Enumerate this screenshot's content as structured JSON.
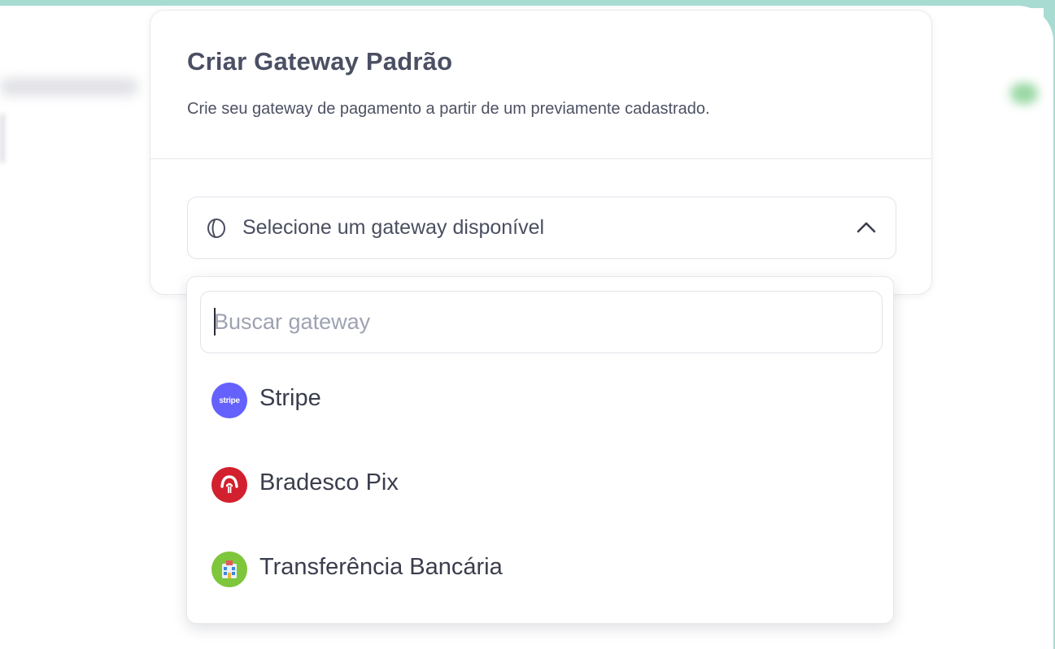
{
  "card": {
    "title": "Criar Gateway Padrão",
    "subtitle": "Crie seu gateway de pagamento a partir de um previamente cadastrado."
  },
  "select": {
    "placeholder": "Selecione um gateway disponível",
    "icon": "coin-icon",
    "state_icon": "chevron-up-icon"
  },
  "dropdown": {
    "search_placeholder": "Buscar gateway",
    "options": [
      {
        "label": "Stripe",
        "icon": "stripe-logo-icon",
        "logo_text": "stripe",
        "color": "#6461fc"
      },
      {
        "label": "Bradesco Pix",
        "icon": "bradesco-logo-icon",
        "color": "#d2202f"
      },
      {
        "label": "Transferência Bancária",
        "icon": "bank-building-icon",
        "color": "#7ec63b"
      }
    ]
  },
  "colors": {
    "frame": "#a8dcd2",
    "title_text": "#4b4f63",
    "border": "#e1e3ea"
  }
}
